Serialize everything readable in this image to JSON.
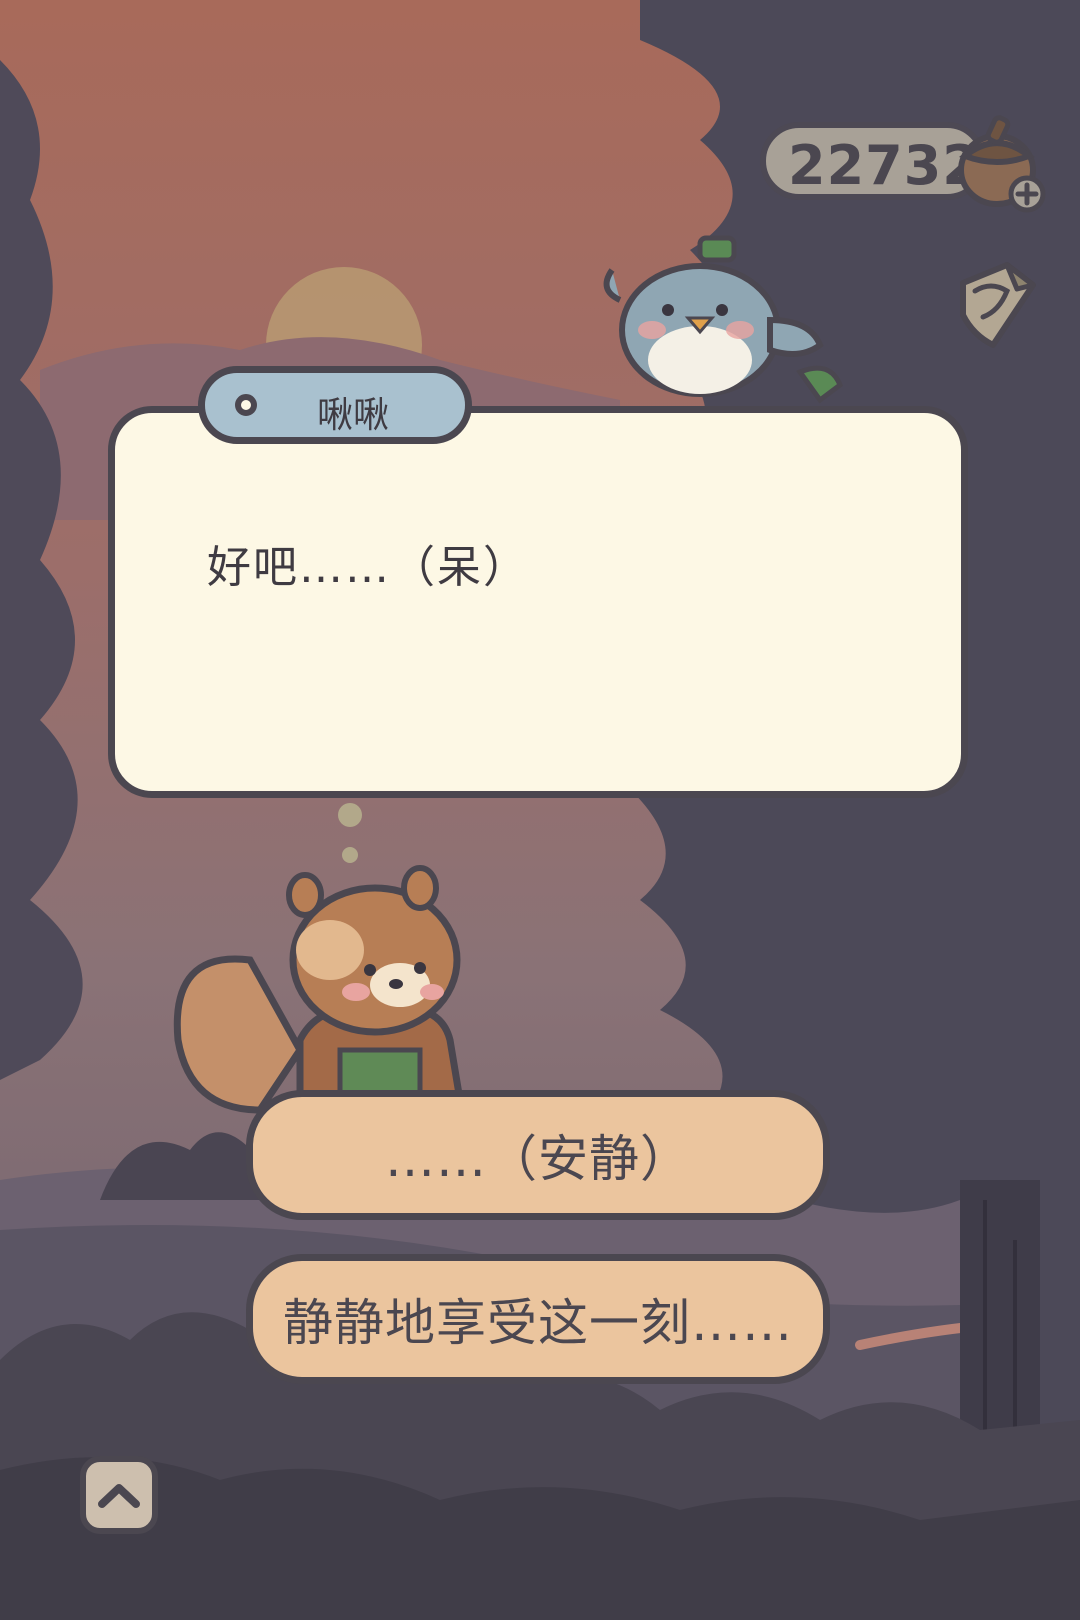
{
  "hud": {
    "currency_value": "22732",
    "currency_icon": "acorn-icon",
    "add_icon": "plus-icon",
    "map_icon": "map-scroll-icon"
  },
  "dialog": {
    "speaker": "啾啾",
    "text": "好吧……（呆）"
  },
  "choices": [
    {
      "label": "……（安静）"
    },
    {
      "label": "静静地享受这一刻……"
    }
  ],
  "controls": {
    "collapse_icon": "chevron-up-icon"
  },
  "colors": {
    "outline": "#4b4750",
    "dialog_bg": "#fdf8e5",
    "name_tag": "#a9c1cf",
    "choice_bg": "#ebc59e",
    "currency_bg": "#a8a197"
  }
}
